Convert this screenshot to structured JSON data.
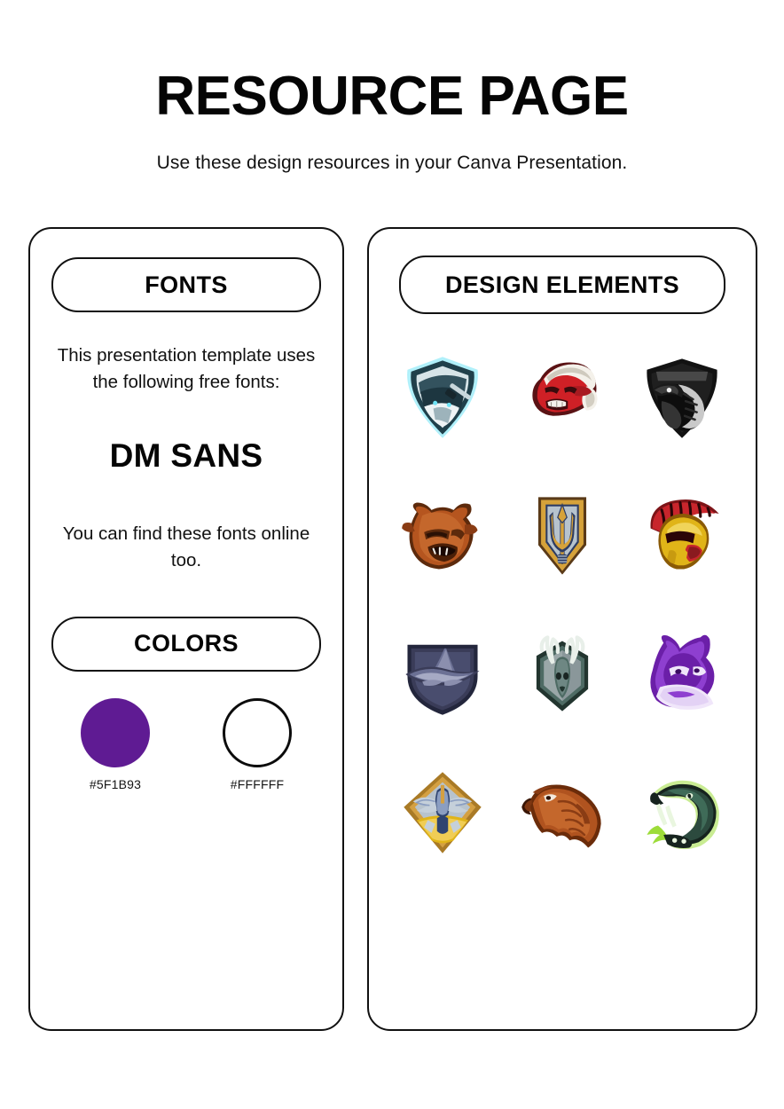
{
  "header": {
    "title": "RESOURCE PAGE",
    "subtitle": "Use these design resources in your Canva Presentation."
  },
  "fonts_panel": {
    "heading": "FONTS",
    "description": "This presentation template uses the following free fonts:",
    "font_name": "DM SANS",
    "note": "You can find these fonts online too."
  },
  "colors_panel": {
    "heading": "COLORS",
    "swatches": [
      {
        "name": "purple-swatch",
        "hex": "#5F1B93",
        "label": "#5F1B93",
        "style": "filled"
      },
      {
        "name": "white-swatch",
        "hex": "#FFFFFF",
        "label": "#FFFFFF",
        "style": "outline"
      }
    ]
  },
  "design_elements_panel": {
    "heading": "DESIGN ELEMENTS",
    "items": [
      {
        "name": "ninja-samurai-shield-icon",
        "row": 1,
        "col": 1,
        "primary_color": "#2b4a55",
        "accent_color": "#6fe3f5"
      },
      {
        "name": "red-demon-head-icon",
        "row": 1,
        "col": 2,
        "primary_color": "#cf2026",
        "accent_color": "#f2efe9"
      },
      {
        "name": "black-cobra-shield-icon",
        "row": 1,
        "col": 3,
        "primary_color": "#1d1d1d",
        "accent_color": "#b9b9b9"
      },
      {
        "name": "brown-bear-head-icon",
        "row": 2,
        "col": 1,
        "primary_color": "#b5551f",
        "accent_color": "#8a3c14"
      },
      {
        "name": "trident-shield-icon",
        "row": 2,
        "col": 2,
        "primary_color": "#d6a23a",
        "accent_color": "#2d3c63"
      },
      {
        "name": "spartan-helmet-warrior-icon",
        "row": 2,
        "col": 3,
        "primary_color": "#e0b418",
        "accent_color": "#c8252c"
      },
      {
        "name": "wizard-hat-shield-icon",
        "row": 3,
        "col": 1,
        "primary_color": "#3a3c58",
        "accent_color": "#8b8fae"
      },
      {
        "name": "deer-stag-badge-icon",
        "row": 3,
        "col": 2,
        "primary_color": "#2f4a48",
        "accent_color": "#9aa7a8"
      },
      {
        "name": "purple-wolf-head-icon",
        "row": 3,
        "col": 3,
        "primary_color": "#6b1fa8",
        "accent_color": "#8e3fd0"
      },
      {
        "name": "winged-knight-crest-icon",
        "row": 4,
        "col": 1,
        "primary_color": "#d4a042",
        "accent_color": "#2f4470"
      },
      {
        "name": "eagle-head-icon",
        "row": 4,
        "col": 2,
        "primary_color": "#b0531f",
        "accent_color": "#7e3712"
      },
      {
        "name": "green-viper-snake-icon",
        "row": 4,
        "col": 3,
        "primary_color": "#2c4a3e",
        "accent_color": "#9ddc3a"
      }
    ]
  }
}
